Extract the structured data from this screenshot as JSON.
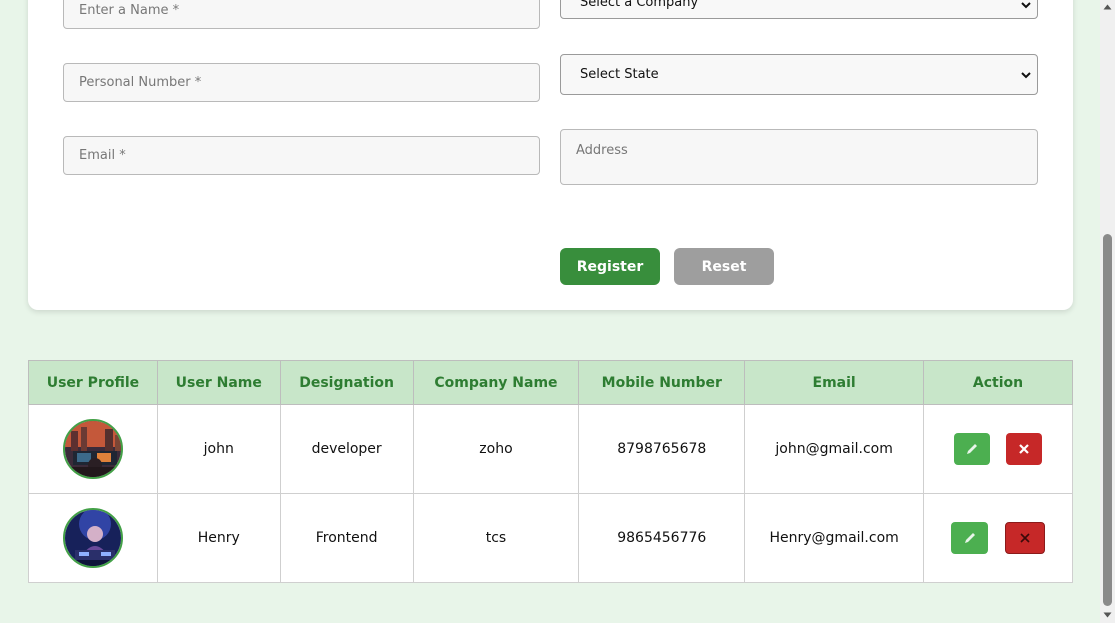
{
  "form": {
    "name_placeholder": "Enter a Name *",
    "personal_number_placeholder": "Personal Number *",
    "email_placeholder": "Email *",
    "company_select_value": "Select a Company",
    "state_select_value": "Select State",
    "address_placeholder": "Address",
    "register_label": "Register",
    "reset_label": "Reset"
  },
  "table": {
    "headers": [
      "User Profile",
      "User Name",
      "Designation",
      "Company Name",
      "Mobile Number",
      "Email",
      "Action"
    ],
    "rows": [
      {
        "user_name": "john",
        "designation": "developer",
        "company": "zoho",
        "mobile": "8798765678",
        "email": "john@gmail.com",
        "avatar_icon": "user-avatar-city-night"
      },
      {
        "user_name": "Henry",
        "designation": "Frontend",
        "company": "tcs",
        "mobile": "9865456776",
        "email": "Henry@gmail.com",
        "avatar_icon": "user-avatar-dj-blue"
      }
    ]
  },
  "colors": {
    "background": "#e8f5e9",
    "header_bg": "#c8e6c9",
    "header_text": "#2e7d32",
    "register": "#388e3c",
    "reset": "#9e9e9e",
    "edit": "#4caf50",
    "delete": "#c62828"
  },
  "icons": {
    "edit": "pencil-icon",
    "delete": "close-icon",
    "select": "chevron-down-icon"
  }
}
